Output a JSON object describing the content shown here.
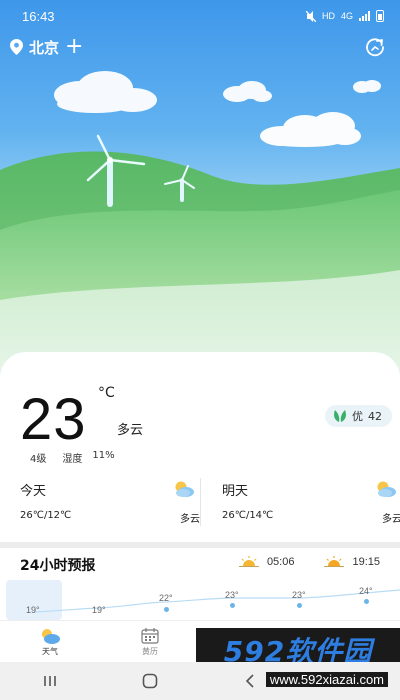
{
  "status": {
    "time": "16:43",
    "icons": [
      "mute-icon",
      "hd-icon",
      "4g-icon",
      "signal-icon",
      "battery-icon"
    ],
    "hd": "HD",
    "net": "4G"
  },
  "header": {
    "city": "北京",
    "add_symbol": "+"
  },
  "current": {
    "temperature": "23",
    "unit": "°C",
    "condition": "多云",
    "wind": "4级",
    "humidity_label": "湿度",
    "humidity_value": "11%",
    "aqi_label": "优",
    "aqi_value": "42"
  },
  "days": [
    {
      "title": "今天",
      "range": "26℃/12℃",
      "condition": "多云"
    },
    {
      "title": "明天",
      "range": "26℃/14℃",
      "condition": "多云"
    }
  ],
  "forecast": {
    "title": "24小时预报",
    "sunrise": "05:06",
    "sunset": "19:15",
    "hours": [
      "19°",
      "19°",
      "22°",
      "23°",
      "23°",
      "24°"
    ]
  },
  "nav": {
    "items": [
      {
        "label": "天气",
        "icon": "weather-icon"
      },
      {
        "label": "黄历",
        "icon": "calendar-icon"
      },
      {
        "label": "",
        "icon": "briefcase-icon"
      },
      {
        "label": "",
        "icon": "profile-icon"
      }
    ]
  },
  "watermark": {
    "brand": "592软件园",
    "url": "www.592xiazai.com"
  },
  "colors": {
    "sky_top": "#3e97ea",
    "grass": "#5cbf63",
    "accent": "#6cb4e8",
    "aqi_leaf": "#38b06a"
  }
}
